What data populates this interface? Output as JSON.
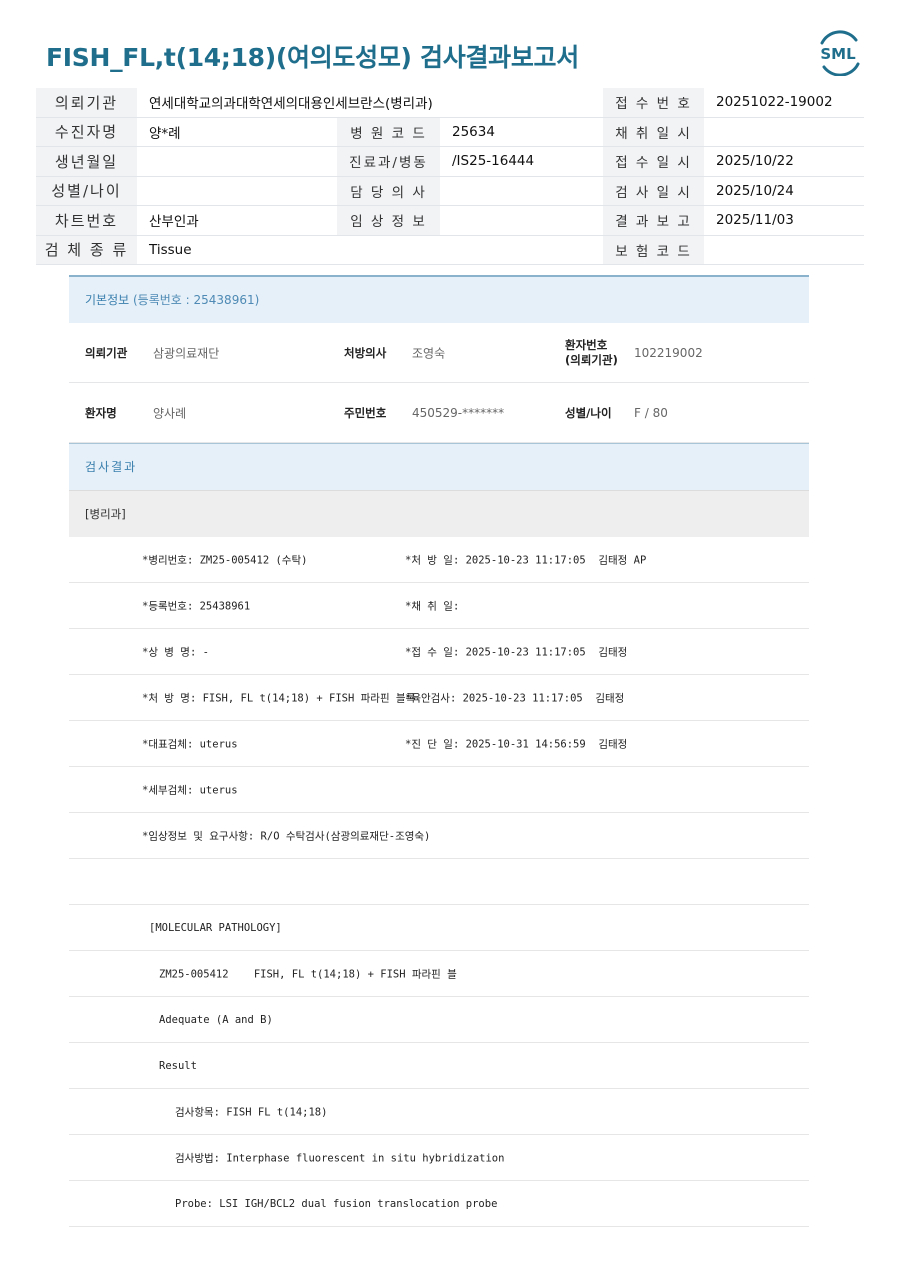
{
  "title": "FISH_FL,t(14;18)(여의도성모) 검사결과보고서",
  "logo": {
    "text": "SML",
    "color": "#1f6e8c"
  },
  "header_rows": [
    {
      "l1": "의뢰기관",
      "v1": "연세대학교의과대학연세의대용인세브란스(병리과)",
      "l2": "",
      "v2": "",
      "l3": "접 수 번 호",
      "v3": "20251022-19002"
    },
    {
      "l1": "수진자명",
      "v1": "양*례",
      "l2": "병 원 코 드",
      "v2": "25634",
      "l3": "채 취 일 시",
      "v3": ""
    },
    {
      "l1": "생년월일",
      "v1": "",
      "l2": "진료과/병동",
      "v2": "/IS25-16444",
      "l3": "접 수 일 시",
      "v3": "2025/10/22"
    },
    {
      "l1": "성별/나이",
      "v1": "",
      "l2": "담 당 의 사",
      "v2": "",
      "l3": "검 사 일 시",
      "v3": "2025/10/24"
    },
    {
      "l1": "차트번호",
      "v1": "산부인과",
      "l2": "임 상 정 보",
      "v2": "",
      "l3": "결 과 보 고",
      "v3": "2025/11/03"
    },
    {
      "l1": "검 체 종 류",
      "v1": "Tissue",
      "l2": "",
      "v2": "",
      "l3": "보 험 코 드",
      "v3": ""
    }
  ],
  "basic": {
    "heading": "기본정보",
    "reg": "(등록번호 : 25438961)",
    "row1": {
      "l1": "의뢰기관",
      "v1": "삼광의료재단",
      "l2": "처방의사",
      "v2": "조영숙",
      "l3a": "환자번호",
      "l3b": "(의뢰기관)",
      "v3": "102219002"
    },
    "row2": {
      "l1": "환자명",
      "v1": "양사례",
      "l2": "주민번호",
      "v2": "450529-*******",
      "l3": "성별/나이",
      "v3": "F / 80"
    }
  },
  "results": {
    "heading": "검사결과",
    "dept": "[병리과]",
    "rows": [
      {
        "a": "*병리번호: ZM25-005412 (수탁)",
        "b": "*처 방 일: 2025-10-23 11:17:05  김태정 AP"
      },
      {
        "a": "*등록번호: 25438961",
        "b": "*채 취 일:"
      },
      {
        "a": "*상 병 명: -",
        "b": "*접 수 일: 2025-10-23 11:17:05  김태정"
      },
      {
        "a": "*처 방 명: FISH, FL t(14;18) + FISH 파라핀 블록",
        "b": "*육안검사: 2025-10-23 11:17:05  김태정"
      },
      {
        "a": "*대표검체: uterus",
        "b": "*진 단 일: 2025-10-31 14:56:59  김태정"
      },
      {
        "a": "*세부검체: uterus",
        "b": ""
      },
      {
        "a": "*임상정보 및 요구사항: R/O 수탁검사(삼광의료재단-조영숙)",
        "b": ""
      },
      {
        "a": "",
        "b": ""
      }
    ],
    "molecular": [
      {
        "text": "[MOLECULAR PATHOLOGY]",
        "indent": 1
      },
      {
        "text": "ZM25-005412    FISH, FL t(14;18) + FISH 파라핀 블",
        "indent": 2
      },
      {
        "text": "Adequate (A and B)",
        "indent": 2
      },
      {
        "text": "Result",
        "indent": 2
      },
      {
        "text": "검사항목: FISH FL t(14;18)",
        "indent": 3
      },
      {
        "text": "검사방법: Interphase fluorescent in situ hybridization",
        "indent": 3
      },
      {
        "text": "Probe: LSI IGH/BCL2 dual fusion translocation probe",
        "indent": 3
      }
    ]
  }
}
